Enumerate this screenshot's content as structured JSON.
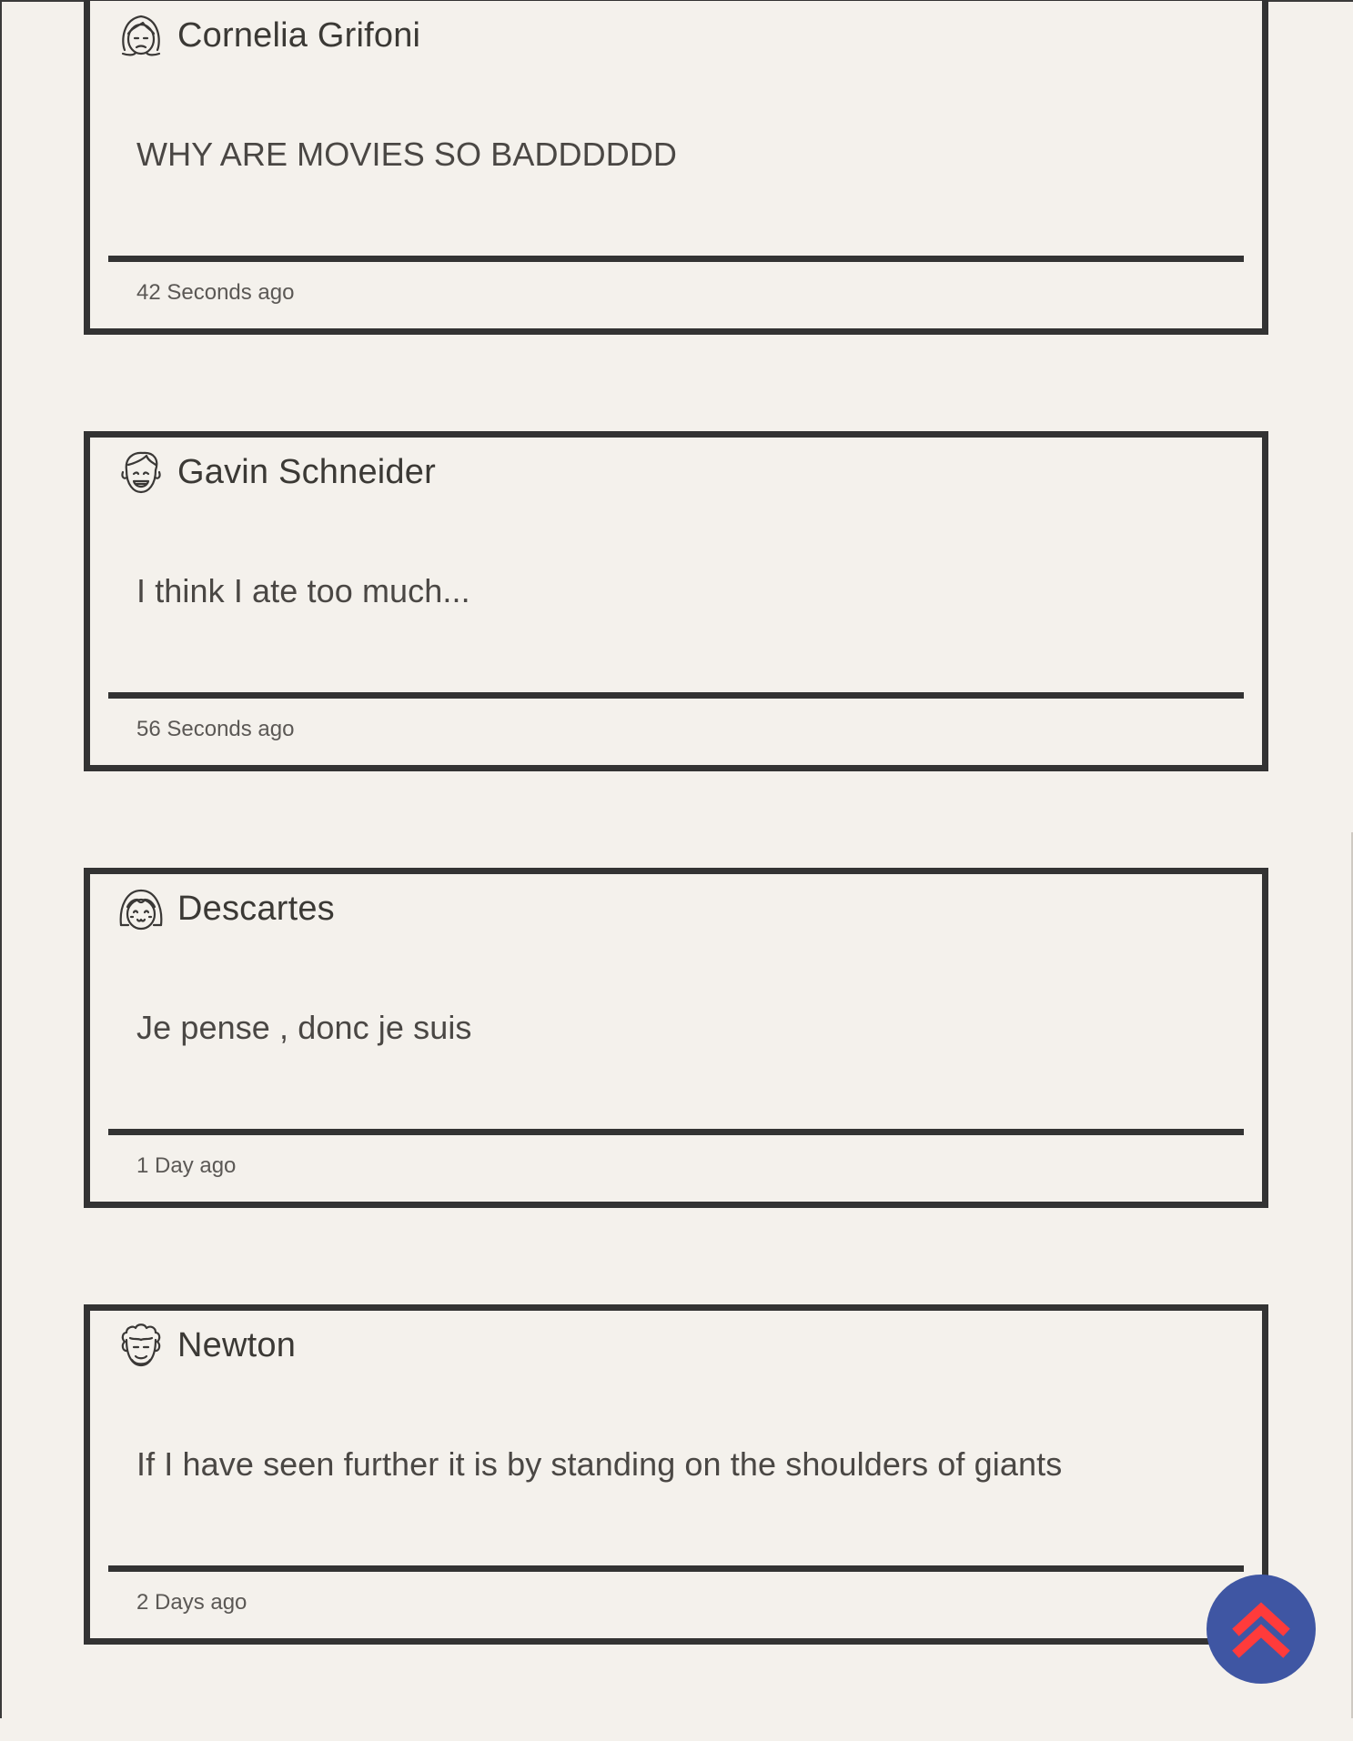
{
  "posts": [
    {
      "author": "Cornelia Grifoni",
      "avatar_icon": "woman-sad-face-icon",
      "body": "WHY ARE MOVIES SO BADDDDDD",
      "time": "42 Seconds ago"
    },
    {
      "author": "Gavin Schneider",
      "avatar_icon": "man-laughing-face-icon",
      "body": "I think I ate too much...",
      "time": "56 Seconds ago"
    },
    {
      "author": "Descartes",
      "avatar_icon": "girl-smiling-face-icon",
      "body": "Je pense , donc je suis",
      "time": "1 Day ago"
    },
    {
      "author": "Newton",
      "avatar_icon": "curly-hair-man-face-icon",
      "body": "If I have seen further it is by standing on the shoulders of giants",
      "time": "2 Days ago"
    }
  ],
  "scroll_top_button": {
    "icon": "double-chevron-up-icon",
    "background_color": "#3f56a3",
    "icon_color": "#ff3b3b"
  },
  "colors": {
    "page_background": "#f4f1ec",
    "card_border": "#333333",
    "text": "#3a3836"
  }
}
